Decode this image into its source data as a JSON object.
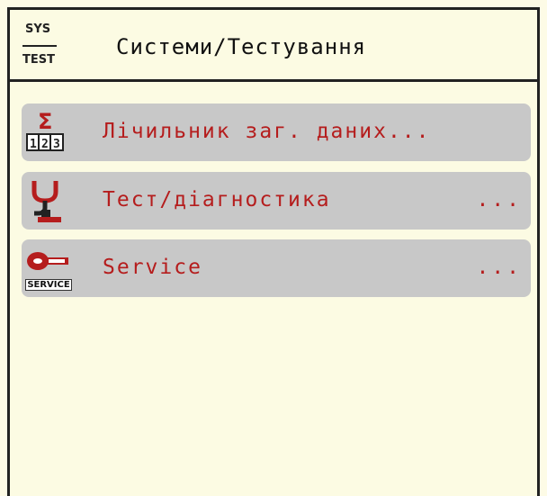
{
  "header": {
    "icon_top": "SYS",
    "icon_bottom": "TEST",
    "title": "Системи/Тестування"
  },
  "menu": [
    {
      "label": "Лічильник заг. даних...",
      "dots": "",
      "icon": "counter-sigma-icon"
    },
    {
      "label": "Тест/діагностика",
      "dots": "...",
      "icon": "stethoscope-icon"
    },
    {
      "label": "Service",
      "dots": "...",
      "icon": "service-key-icon",
      "icon_text": "SERVICE"
    }
  ],
  "colors": {
    "background": "#fcfbe3",
    "item_bg": "#c8c8c8",
    "accent_red": "#b51d1d"
  }
}
